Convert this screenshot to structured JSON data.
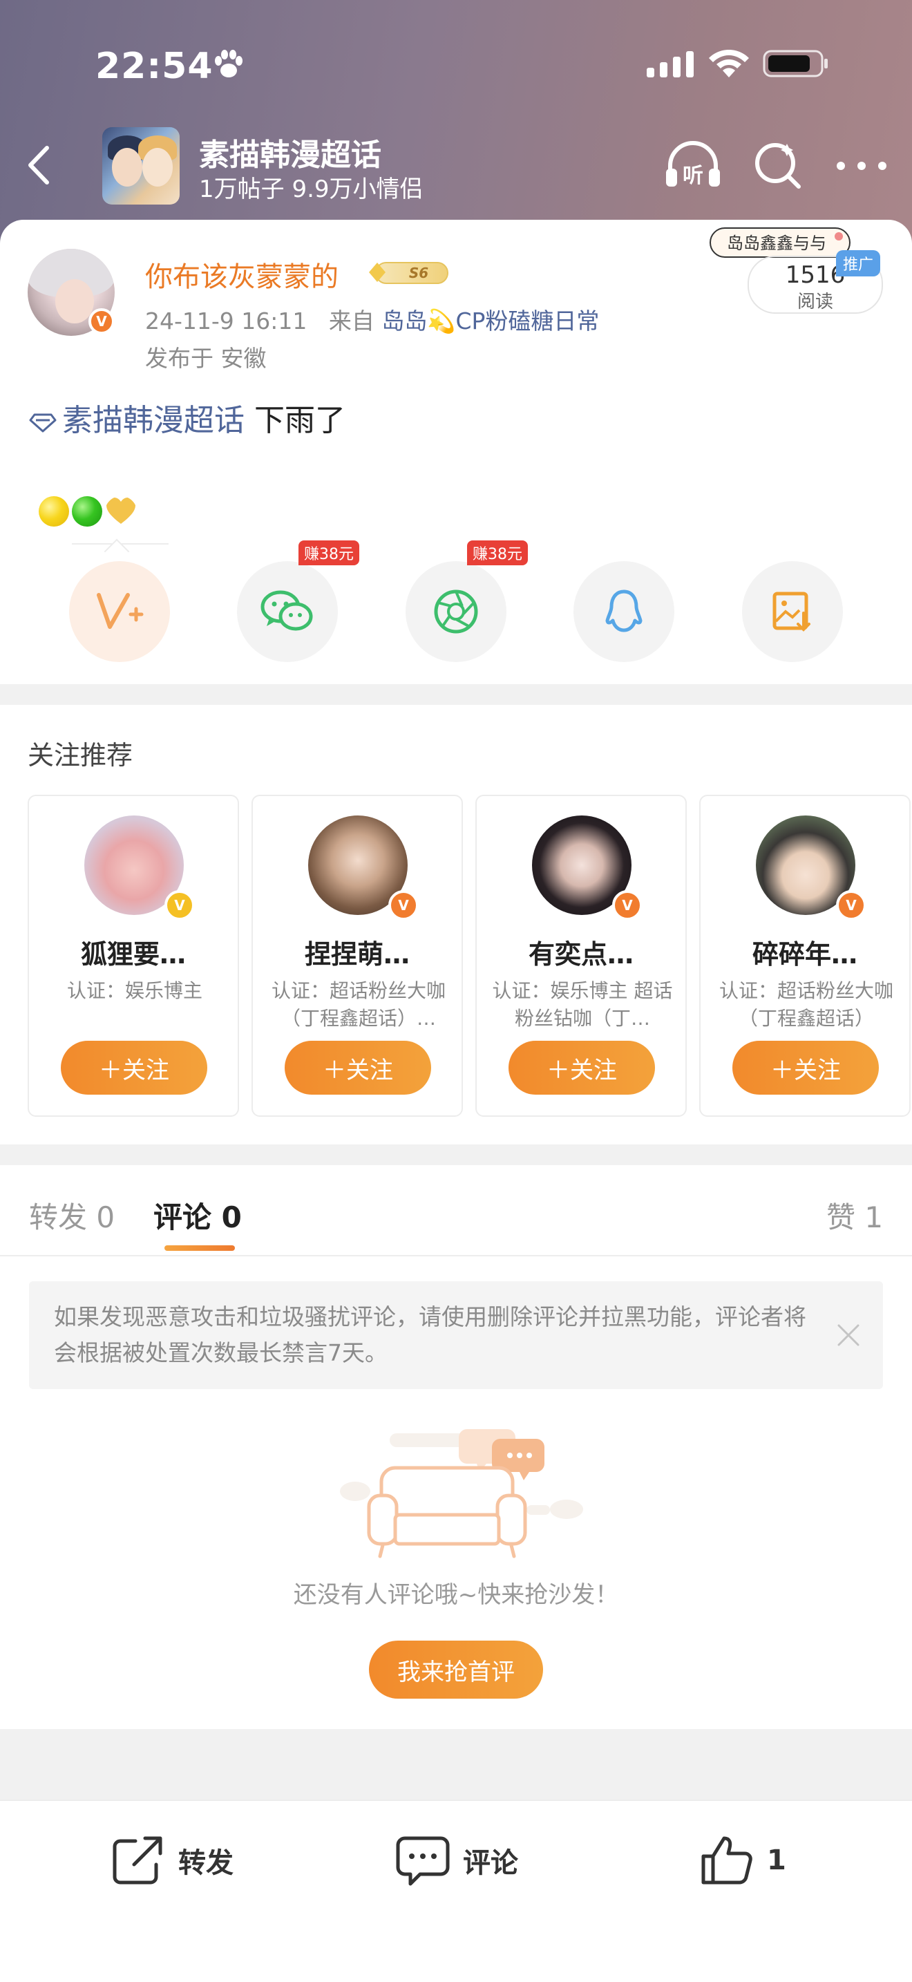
{
  "status_bar": {
    "time": "22:54"
  },
  "header": {
    "topic_title": "素描韩漫超话",
    "topic_stats": "1万帖子 9.9万小情侣",
    "listen_label": "听"
  },
  "post": {
    "author_name": "你布该灰蒙蒙的",
    "level_label": "S6",
    "date": "24-11-9 16:11",
    "from_prefix": "来自",
    "from_source": "岛岛💫CP粉磕糖日常",
    "location": "发布于 安徽",
    "promo_text": "岛岛鑫鑫与与",
    "ad_label": "推广",
    "read_count": "1516",
    "read_label": "阅读",
    "topic_link": "素描韩漫超话",
    "body": " 下雨了",
    "earn_label_1": "赚38元",
    "earn_label_2": "赚38元"
  },
  "recommend": {
    "title": "关注推荐",
    "follow_label": "＋关注",
    "users": [
      {
        "name": "狐狸要…",
        "desc": "认证：娱乐博主",
        "badge": "yellow"
      },
      {
        "name": "捏捏萌…",
        "desc": "认证：超话粉丝大咖（丁程鑫超话）…",
        "badge": "orange"
      },
      {
        "name": "有奕点…",
        "desc": "认证：娱乐博主 超话粉丝钻咖（丁…",
        "badge": "orange"
      },
      {
        "name": "碎碎年…",
        "desc": "认证：超话粉丝大咖（丁程鑫超话）",
        "badge": "orange"
      }
    ]
  },
  "comments": {
    "tab_repost": "转发 0",
    "tab_comment": "评论 0",
    "tab_like": "赞 1",
    "notice": "如果发现恶意攻击和垃圾骚扰评论，请使用删除评论并拉黑功能，评论者将会根据被处置次数最长禁言7天。",
    "empty_text": "还没有人评论哦~快来抢沙发！",
    "first_comment_label": "我来抢首评"
  },
  "bottom_bar": {
    "repost_label": "转发",
    "comment_label": "评论",
    "like_count": "1"
  },
  "colors": {
    "accent_orange": "#ea7a25",
    "link_blue": "#50669a",
    "button_orange": "#f28a2c"
  }
}
